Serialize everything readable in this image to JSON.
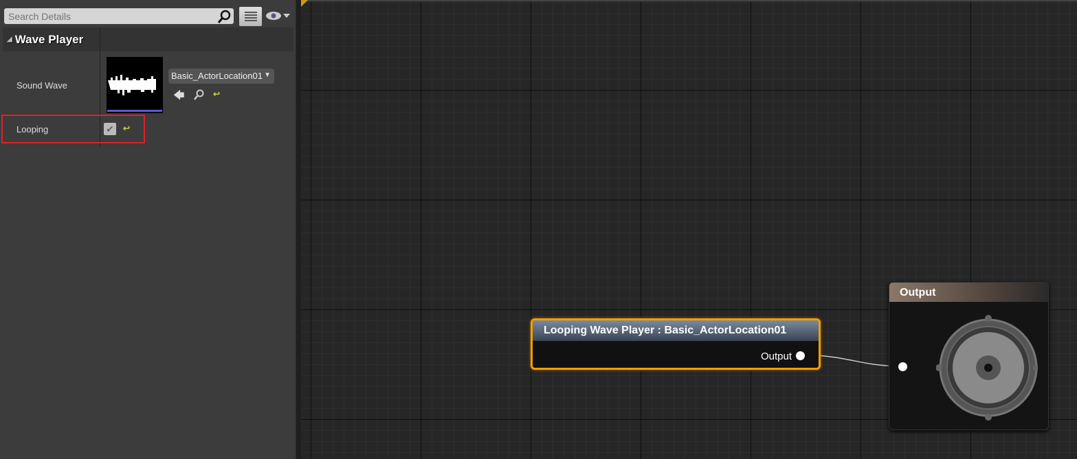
{
  "details": {
    "search_placeholder": "Search Details",
    "category": "Wave Player",
    "sound_wave_label": "Sound Wave",
    "sound_wave_value": "Basic_ActorLocation01",
    "looping_label": "Looping",
    "looping_checked": true
  },
  "graph": {
    "wave_player_node": {
      "title": "Looping Wave Player : Basic_ActorLocation01",
      "output_pin": "Output"
    },
    "output_node": {
      "title": "Output"
    }
  },
  "colors": {
    "highlight": "#e0202a",
    "selected_node_border": "#f0a000"
  }
}
